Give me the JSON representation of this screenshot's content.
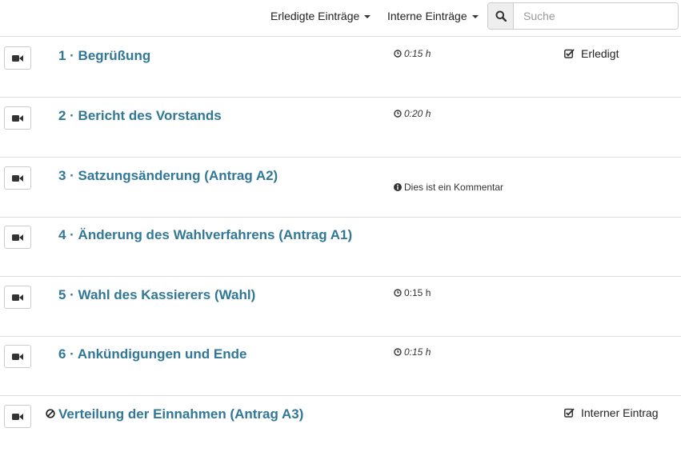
{
  "toolbar": {
    "done_filter_label": "Erledigte Einträge",
    "internal_filter_label": "Interne Einträge",
    "search_placeholder": "Suche",
    "search_value": ""
  },
  "items": [
    {
      "title": "1 · Begrüßung",
      "duration": "0:15 h",
      "duration_italic": true,
      "status": "Erledigt"
    },
    {
      "title": "2 · Bericht des Vorstands",
      "duration": "0:20 h",
      "duration_italic": true
    },
    {
      "title": "3 · Satzungsänderung (Antrag A2)",
      "comment": "Dies ist ein Kommentar"
    },
    {
      "title": "4 · Änderung des Wahlverfahrens (Antrag A1)"
    },
    {
      "title": "5 · Wahl des Kassierers (Wahl)",
      "duration": "0:15 h",
      "duration_italic": false
    },
    {
      "title": "6 · Ankündigungen und Ende",
      "duration": "0:15 h",
      "duration_italic": true
    },
    {
      "title": "Verteilung der Einnahmen (Antrag A3)",
      "status": "Interner Eintrag",
      "hidden": true
    }
  ],
  "icons": {
    "camera": "video-camera-icon",
    "clock": "clock-icon",
    "info": "info-icon",
    "checked": "checkbox-checked-icon",
    "hidden": "ban-icon",
    "search": "search-icon"
  },
  "colors": {
    "link": "#317796",
    "border": "#dddddd",
    "button_bg": "#eeeeee"
  }
}
